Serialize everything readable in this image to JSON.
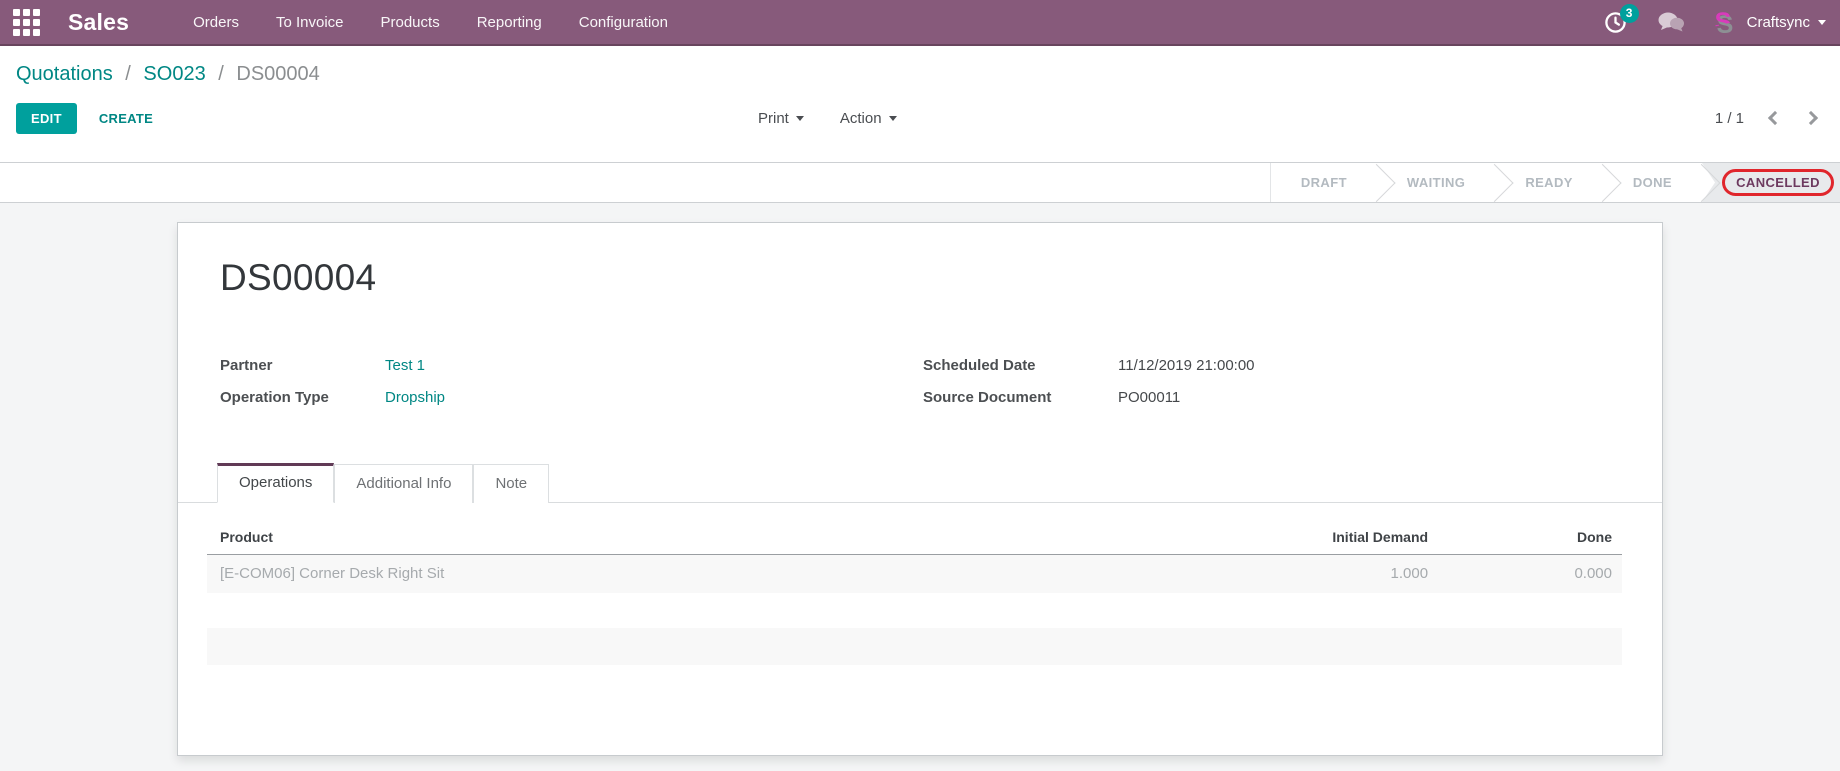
{
  "nav": {
    "app_name": "Sales",
    "menu": [
      "Orders",
      "To Invoice",
      "Products",
      "Reporting",
      "Configuration"
    ],
    "activity_badge": "3",
    "user_name": "Craftsync"
  },
  "breadcrumb": {
    "separator": "/",
    "items": [
      {
        "label": "Quotations"
      },
      {
        "label": "SO023"
      },
      {
        "label": "DS00004"
      }
    ]
  },
  "controls": {
    "edit_label": "EDIT",
    "create_label": "CREATE",
    "print_label": "Print",
    "action_label": "Action",
    "pager": "1 / 1"
  },
  "statusbar": {
    "steps": [
      {
        "label": "DRAFT"
      },
      {
        "label": "WAITING"
      },
      {
        "label": "READY"
      },
      {
        "label": "DONE"
      },
      {
        "label": "CANCELLED"
      }
    ],
    "active_step": "CANCELLED"
  },
  "form": {
    "title": "DS00004",
    "fields_left": [
      {
        "label": "Partner",
        "value": "Test 1"
      },
      {
        "label": "Operation Type",
        "value": "Dropship"
      }
    ],
    "fields_right": [
      {
        "label": "Scheduled Date",
        "value": "11/12/2019 21:00:00"
      },
      {
        "label": "Source Document",
        "value": "PO00011"
      }
    ],
    "tabs": [
      {
        "label": "Operations",
        "active": true
      },
      {
        "label": "Additional Info",
        "active": false
      },
      {
        "label": "Note",
        "active": false
      }
    ],
    "table": {
      "columns": [
        "Product",
        "Initial Demand",
        "Done"
      ],
      "rows": [
        {
          "product": "[E-COM06] Corner Desk Right Sit",
          "initial_demand": "1.000",
          "done": "0.000"
        }
      ]
    }
  },
  "colors": {
    "navbar": "#875A7B",
    "accent_teal": "#00A09D",
    "link_teal": "#008784",
    "cancelled_text": "#6d3a5f",
    "highlight_red": "#e0262c",
    "page_bg": "#f4f5f6"
  }
}
